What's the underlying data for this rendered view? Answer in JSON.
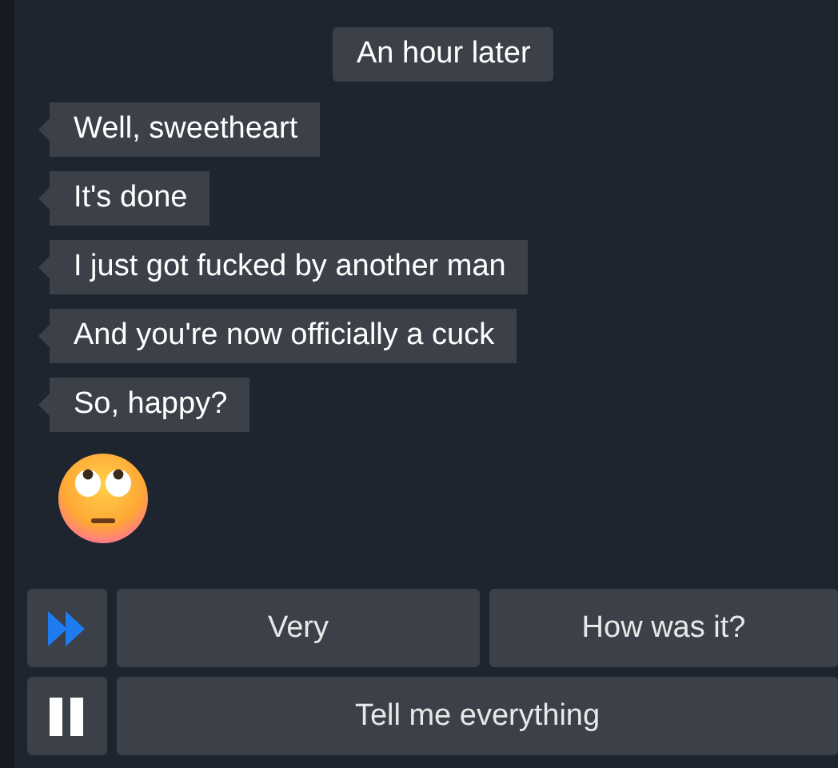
{
  "time_divider": "An hour later",
  "messages": [
    {
      "text": "Well, sweetheart"
    },
    {
      "text": "It's done"
    },
    {
      "text": "I just got fucked by another man"
    },
    {
      "text": "And you're now officially a cuck"
    },
    {
      "text": "So, happy?"
    }
  ],
  "choices": [
    {
      "label": "Very"
    },
    {
      "label": "How was it?"
    },
    {
      "label": "Tell me everything"
    }
  ]
}
